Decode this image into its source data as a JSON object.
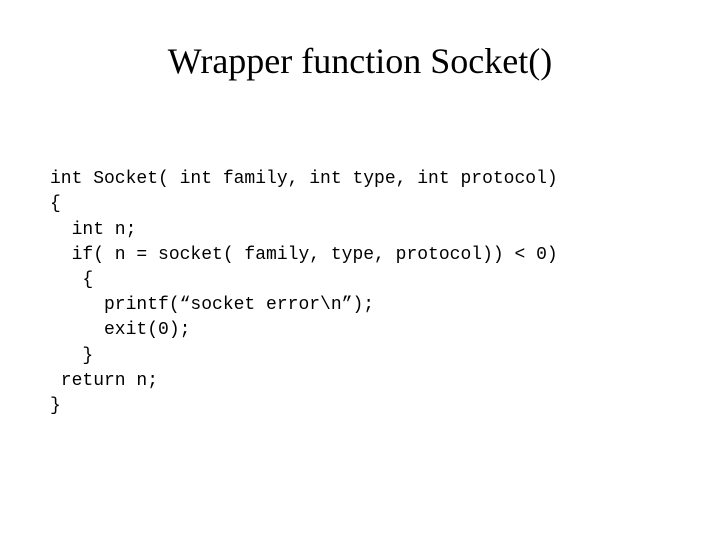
{
  "title": "Wrapper function Socket()",
  "code": {
    "line1": "int Socket( int family, int type, int protocol)",
    "line2": "{",
    "line3": "  int n;",
    "line4": "  if( n = socket( family, type, protocol)) < 0)",
    "line5": "   {",
    "line6": "     printf(“socket error\\n”);",
    "line7": "     exit(0);",
    "line8": "   }",
    "line9": " return n;",
    "line10": "}"
  }
}
